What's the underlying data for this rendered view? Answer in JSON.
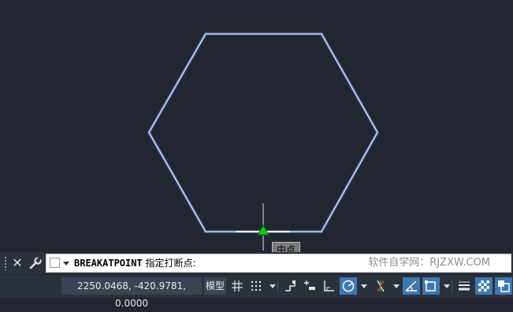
{
  "drawing": {
    "shape": "hexagon",
    "shape_color": "#b8c8ff",
    "snap_marker": "midpoint-triangle",
    "snap_color": "#19c919"
  },
  "tooltip": {
    "label": "中点"
  },
  "command_line": {
    "command": "BREAKATPOINT",
    "prompt": " 指定打断点:",
    "watermark": "软件自学网：RJZXW.COM"
  },
  "status_bar": {
    "coordinates": "2250.0468, -420.9781, 0.0000",
    "model_label": "模型",
    "icons": [
      "grid-icon",
      "snap-icon",
      "infer-constraints-icon",
      "dynamic-input-icon",
      "ortho-icon",
      "polar-icon",
      "isodraft-icon",
      "osnap-tracking-icon",
      "osnap-icon",
      "lineweight-icon",
      "transparency-icon",
      "selection-cycling-icon"
    ]
  },
  "colors": {
    "background": "#212630",
    "bar": "#2b313b",
    "active": "#3e78b0"
  }
}
